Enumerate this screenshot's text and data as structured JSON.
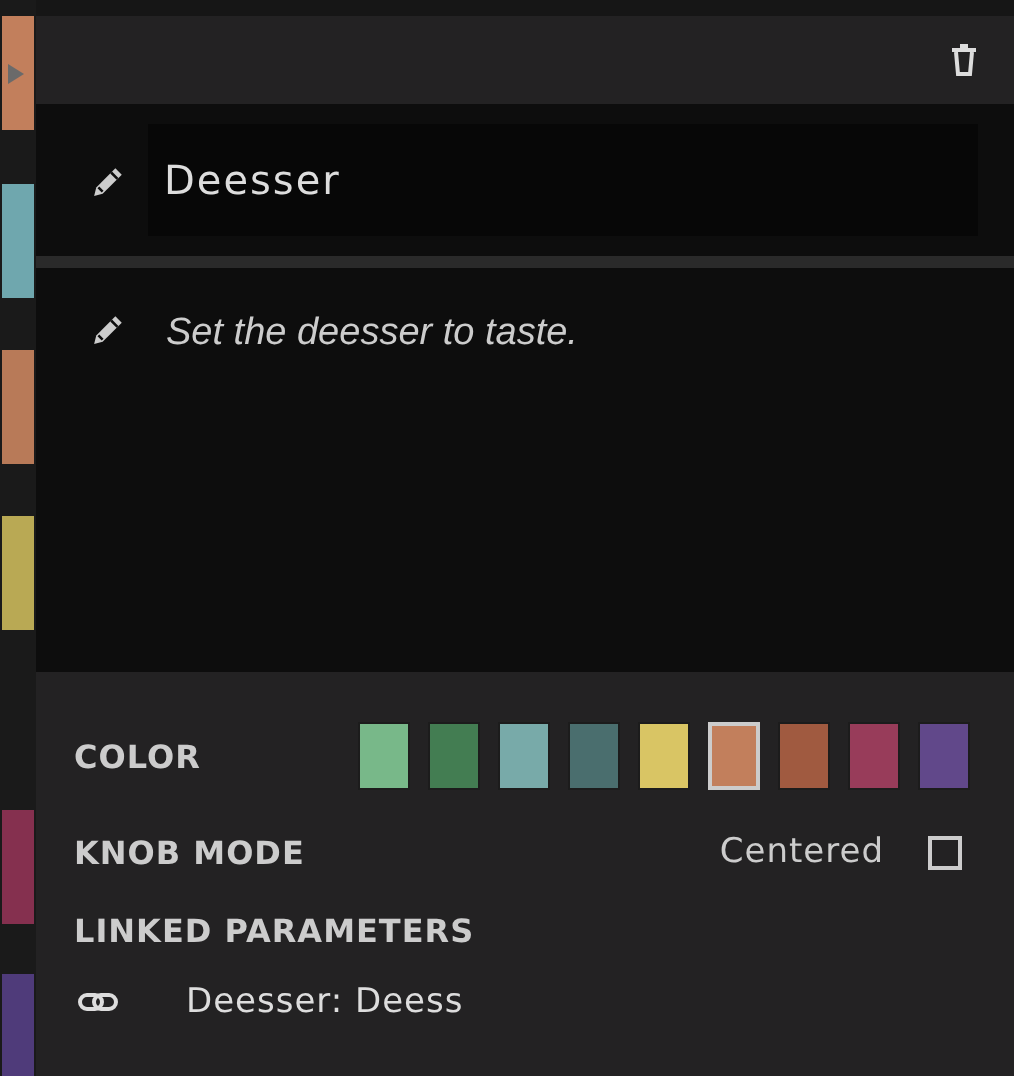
{
  "track_strip": [
    {
      "color": "#c27f5c",
      "selected": true
    },
    {
      "color": "#6fa7ae",
      "selected": false
    },
    {
      "color": "#b87a58",
      "selected": false
    },
    {
      "color": "#b9a954",
      "selected": false
    },
    {
      "color": "#85304f",
      "selected": false
    },
    {
      "color": "#4f3b7a",
      "selected": false
    }
  ],
  "name": {
    "value": "Deesser"
  },
  "notes": {
    "value": "Set the deesser to taste."
  },
  "color": {
    "label": "COLOR",
    "swatches": [
      {
        "color": "#78b889",
        "selected": false
      },
      {
        "color": "#437d52",
        "selected": false
      },
      {
        "color": "#78aaa9",
        "selected": false
      },
      {
        "color": "#4a6e6e",
        "selected": false
      },
      {
        "color": "#d9c564",
        "selected": false
      },
      {
        "color": "#c27f5c",
        "selected": true
      },
      {
        "color": "#a05a40",
        "selected": false
      },
      {
        "color": "#983c5a",
        "selected": false
      },
      {
        "color": "#61488a",
        "selected": false
      }
    ]
  },
  "knob_mode": {
    "label": "KNOB MODE",
    "option": "Centered",
    "checked": false
  },
  "linked_parameters": {
    "label": "LINKED PARAMETERS",
    "items": [
      "Deesser: Deess"
    ]
  }
}
